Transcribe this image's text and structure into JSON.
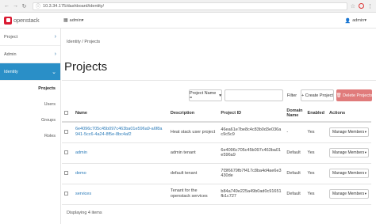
{
  "browser": {
    "url": "10.3.34.175/dashboard/identity/",
    "url_prefix": "ⓘ"
  },
  "topbar": {
    "logo_text": "openstack",
    "project_selector": "admin",
    "user": "admin"
  },
  "sidebar": {
    "sections": [
      {
        "label": "Project",
        "active": false
      },
      {
        "label": "Admin",
        "active": false
      },
      {
        "label": "Identity",
        "active": true
      }
    ],
    "items": [
      {
        "label": "Projects",
        "active": true
      },
      {
        "label": "Users",
        "active": false
      },
      {
        "label": "Groups",
        "active": false
      },
      {
        "label": "Roles",
        "active": false
      }
    ]
  },
  "main": {
    "breadcrumb": "Identity / Projects",
    "title": "Projects",
    "toolbar": {
      "filter_select": "Project Name =",
      "filter_input_value": "",
      "filter_label": "Filter",
      "create_label": "+ Create Project",
      "delete_label": "🗑 Delete Projects"
    },
    "table": {
      "headers": [
        "Name",
        "Description",
        "Project ID",
        "Domain Name",
        "Enabled",
        "Actions"
      ],
      "rows": [
        {
          "name": "6e4096c705c45b097c463ba01e596a9-a6f8a941-5cc6-4a24-8f5e-8bc4af2",
          "description": "Heat stack user project",
          "project_id": "46ea61e7be8c4c83b0d3e036ac9c5c9",
          "domain": "-",
          "enabled": "Yes",
          "action": "Manage Members"
        },
        {
          "name": "admin",
          "description": "admin tenant",
          "project_id": "6e4096c705c45b097c463ba01e596a9",
          "domain": "Default",
          "enabled": "Yes",
          "action": "Manage Members"
        },
        {
          "name": "demo",
          "description": "default tenant",
          "project_id": "7f3f6679fb7f417c8ba4d4ae6e3430de",
          "domain": "Default",
          "enabled": "Yes",
          "action": "Manage Members"
        },
        {
          "name": "services",
          "description": "Tenant for the openstack services",
          "project_id": "b84a749e225a49b0ad0c91651fb1c727",
          "domain": "Default",
          "enabled": "Yes",
          "action": "Manage Members"
        }
      ]
    },
    "footer": "Displaying 4 items"
  }
}
